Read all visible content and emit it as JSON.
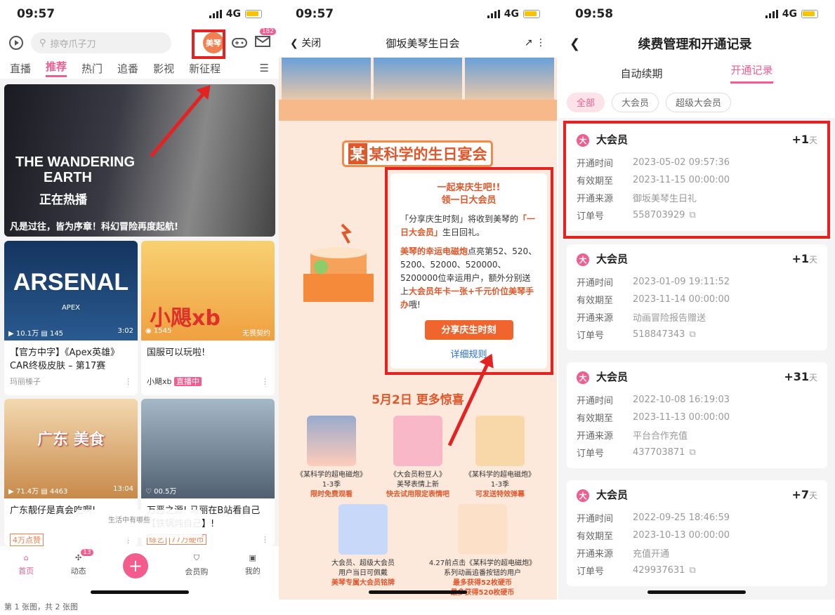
{
  "left": {
    "status": {
      "time": "09:57",
      "net": "4G"
    },
    "search_placeholder": "掠夺爪子刀",
    "avatar_label": "美琴",
    "mail_count": "182",
    "tabs": [
      "直播",
      "推荐",
      "热门",
      "追番",
      "影视",
      "新征程"
    ],
    "banner": {
      "caption": "凡是过往，皆为序章！科幻冒险再度起航!",
      "film_line1": "THE WANDERING",
      "film_line2": "EARTH",
      "badge": "正在热播"
    },
    "cards": [
      {
        "title": "【官方中字】《Apex英雄》CAR终极皮肤 – 第17赛季：…",
        "views": "10.1万",
        "danmaku": "145",
        "duration": "3:02",
        "author": "玛丽榛子",
        "thumb_text": "ARSENAL",
        "thumb_sub": "APEX"
      },
      {
        "title": "国服可以玩啦!",
        "views": "1545",
        "author": "小飓xb",
        "live": "直播中",
        "thumb_text": "小飓xb",
        "tag": "无畏契约"
      },
      {
        "title": "广东靓仔是真会吃啊!",
        "views": "71.4万",
        "danmaku": "4463",
        "duration": "13:04",
        "tag": "4万点赞",
        "thumb_text": "广东 美食"
      },
      {
        "title": "万恶之源! 马丽在B站看自己【铁锅炖自己】!",
        "likes": "00.5万",
        "tag1": "综艺",
        "tag2": "77万硬币"
      }
    ],
    "nav": [
      "首页",
      "动态",
      "",
      "会员购",
      "我的"
    ],
    "dyn_count": "13",
    "popup": "生活中有哪些"
  },
  "middle": {
    "status": {
      "time": "09:57",
      "net": "4G"
    },
    "close": "关闭",
    "title": "御坂美琴生日会",
    "event_title": "某科学的生日宴会",
    "event_title_mark": "某",
    "heading1": "一起来庆生吧!!",
    "heading2": "领一日大会员",
    "p1": "「分享庆生时刻」将收到美琴的",
    "p1b": "「一日大会员」",
    "p1c": "生日回礼。",
    "p2a": "美琴的幸运电磁炮",
    "p2b": "点亮第52、520、5200、52000、520000、5200000位幸运用户，额外分别送上",
    "p2c": "大会员年卡一张+千元价位美琴手办",
    "p2d": "哦!",
    "share": "分享庆生时刻",
    "detail": "详细规则",
    "section": "5月2日 更多惊喜",
    "gifts": [
      {
        "name": "《某科学的超电磁炮》",
        "sub": "1-3季",
        "note": "限时免费观看"
      },
      {
        "name": "《大会员粉豆人》",
        "sub": "美琴表情上新",
        "note": "快去试用限定表情吧"
      },
      {
        "name": "《某科学的超电磁炮》",
        "sub": "1-3季",
        "note": "可发送特效弹幕"
      },
      {
        "name": "大会员、超级大会员",
        "sub": "用户当日可佩戴",
        "note": "美琴专属大会员铭牌"
      },
      {
        "name": "4.27前点击《某科学的超电磁炮》",
        "sub": "系列动画追番按钮的用户",
        "note": "最多获得52枚硬币",
        "note2": "最多获得520枚硬币"
      }
    ]
  },
  "right": {
    "status": {
      "time": "09:58",
      "net": "4G"
    },
    "title": "续费管理和开通记录",
    "tabs": [
      "自动续期",
      "开通记录"
    ],
    "filters": [
      "全部",
      "大会员",
      "超级大会员"
    ],
    "labels": [
      "开通时间",
      "有效期至",
      "开通来源",
      "订单号"
    ],
    "records": [
      {
        "type": "大会员",
        "add": "+1",
        "unit": "天",
        "open": "2023-05-02 09:57:36",
        "expire": "2023-11-15 00:00:00",
        "source": "御坂美琴生日礼",
        "order": "558703929"
      },
      {
        "type": "大会员",
        "add": "+1",
        "unit": "天",
        "open": "2023-01-09 19:11:52",
        "expire": "2023-11-14 00:00:00",
        "source": "动画冒险报告赠送",
        "order": "518847343"
      },
      {
        "type": "大会员",
        "add": "+31",
        "unit": "天",
        "open": "2022-10-08 16:19:03",
        "expire": "2023-11-13 00:00:00",
        "source": "平台合作充值",
        "order": "437703871"
      },
      {
        "type": "大会员",
        "add": "+7",
        "unit": "天",
        "open": "2022-09-25 18:46:59",
        "expire": "2023-10-13 00:00:00",
        "source": "充值开通",
        "order": "429937631"
      }
    ]
  },
  "footer": "第 1 张图，共 2 张图",
  "colors": {
    "accent": "#f25d8e",
    "highlight": "#e32222",
    "orange": "#e0572a"
  }
}
